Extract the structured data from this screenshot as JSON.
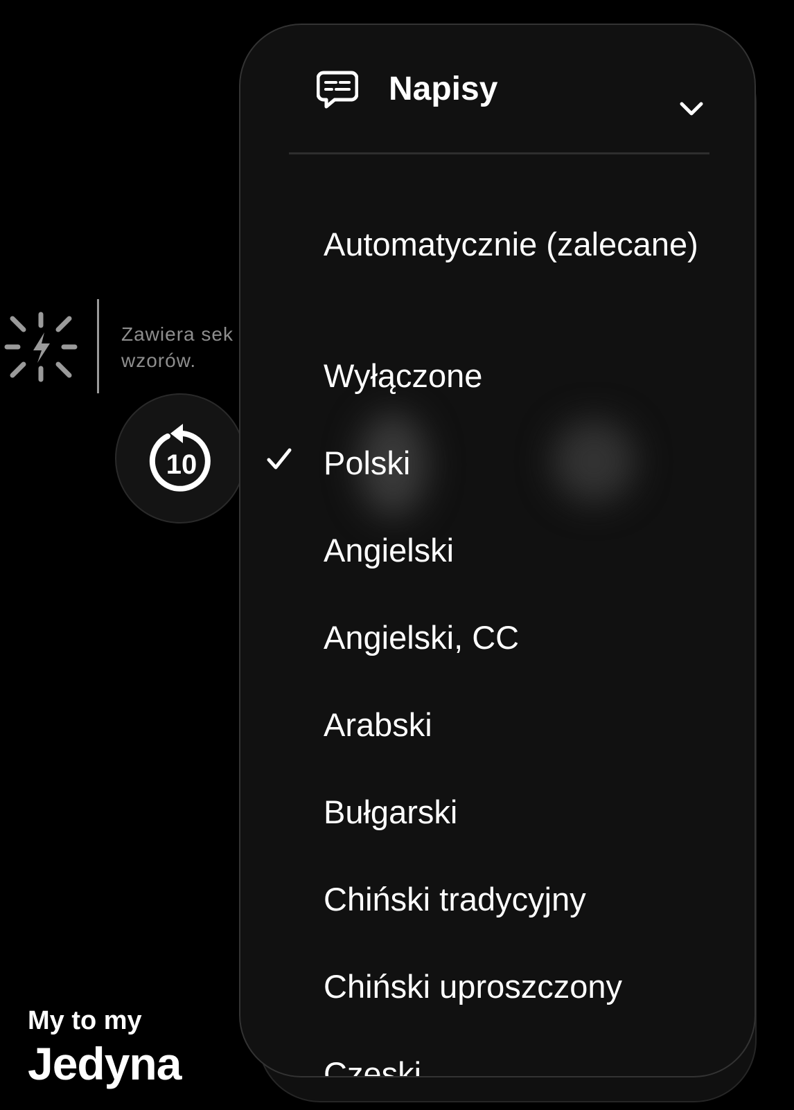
{
  "player": {
    "warning_text_line1": "Zawiera sek",
    "warning_text_line2": "wzorów.",
    "warning_icon": "flashing-lights-icon",
    "replay_icon": "replay-10-icon",
    "replay_seconds": "10",
    "show_eyebrow": "My to my",
    "show_title": "Jedyna"
  },
  "menu": {
    "header": {
      "icon": "subtitles-icon",
      "title": "Napisy",
      "chevron_icon": "chevron-down-icon"
    },
    "options": [
      {
        "label": "Automatycznie (zalecane)",
        "selected": false
      },
      {
        "label": "Wyłączone",
        "selected": false
      },
      {
        "label": "Polski",
        "selected": true
      },
      {
        "label": "Angielski",
        "selected": false
      },
      {
        "label": "Angielski, CC",
        "selected": false
      },
      {
        "label": "Arabski",
        "selected": false
      },
      {
        "label": "Bułgarski",
        "selected": false
      },
      {
        "label": "Chiński tradycyjny",
        "selected": false
      },
      {
        "label": "Chiński uproszczony",
        "selected": false
      },
      {
        "label": "Czeski",
        "selected": false
      }
    ]
  },
  "colors": {
    "background": "#000000",
    "panel": "#111111",
    "text": "#ffffff",
    "muted_text": "#8e8e8e"
  }
}
